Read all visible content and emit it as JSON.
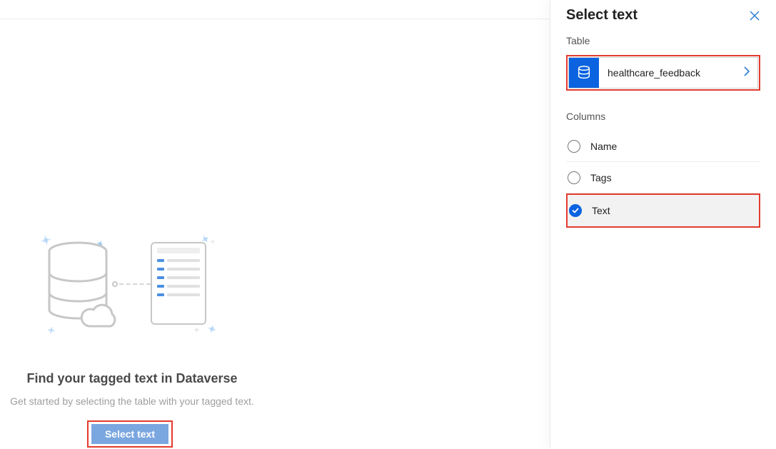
{
  "hero": {
    "title": "Find your tagged text in Dataverse",
    "subtitle": "Get started by selecting the table with your tagged text.",
    "button_label": "Select text"
  },
  "panel": {
    "title": "Select text",
    "table_section_label": "Table",
    "selected_table": "healthcare_feedback",
    "columns_section_label": "Columns",
    "columns": [
      {
        "label": "Name",
        "selected": false
      },
      {
        "label": "Tags",
        "selected": false
      },
      {
        "label": "Text",
        "selected": true
      }
    ]
  }
}
